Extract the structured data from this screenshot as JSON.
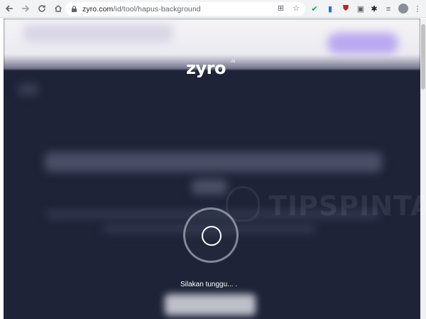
{
  "browser": {
    "url_host": "zyro.com",
    "url_path": "/id/tool/hapus-background"
  },
  "page": {
    "logo_text": "zyro",
    "logo_suffix": ".AI",
    "loading_text": "Silakan tunggu... .",
    "watermark_text": "TIPSPINTAR"
  },
  "colors": {
    "page_background": "#1e2338",
    "header_band": "#f4f4f6",
    "accent_blurred_button": "#b9a8f0"
  }
}
